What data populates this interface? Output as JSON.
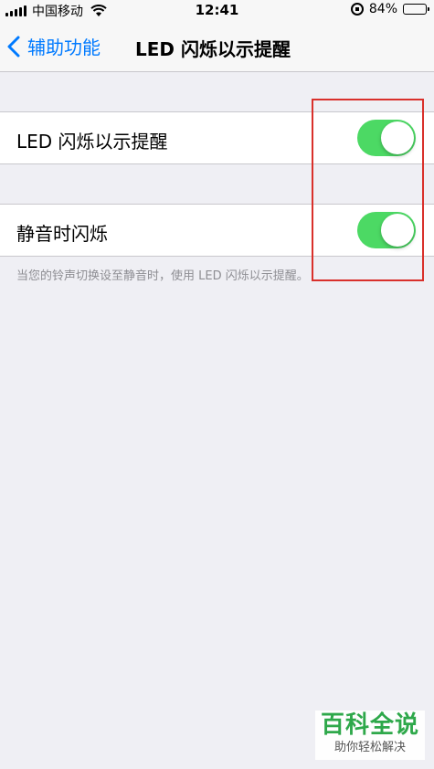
{
  "status_bar": {
    "carrier": "中国移动",
    "time": "12:41",
    "battery_percent": "84%",
    "battery_level": 0.84
  },
  "nav": {
    "back_label": "辅助功能",
    "title": "LED 闪烁以示提醒"
  },
  "settings": [
    {
      "label": "LED 闪烁以示提醒",
      "enabled": true
    },
    {
      "label": "静音时闪烁",
      "enabled": true
    }
  ],
  "footnote": "当您的铃声切换设至静音时，使用 LED 闪烁以示提醒。",
  "colors": {
    "accent": "#007aff",
    "toggle_on": "#4cd964",
    "highlight": "#d9302b",
    "background": "#efeff4"
  },
  "watermark": {
    "title": "百科全说",
    "subtitle": "助你轻松解决"
  }
}
